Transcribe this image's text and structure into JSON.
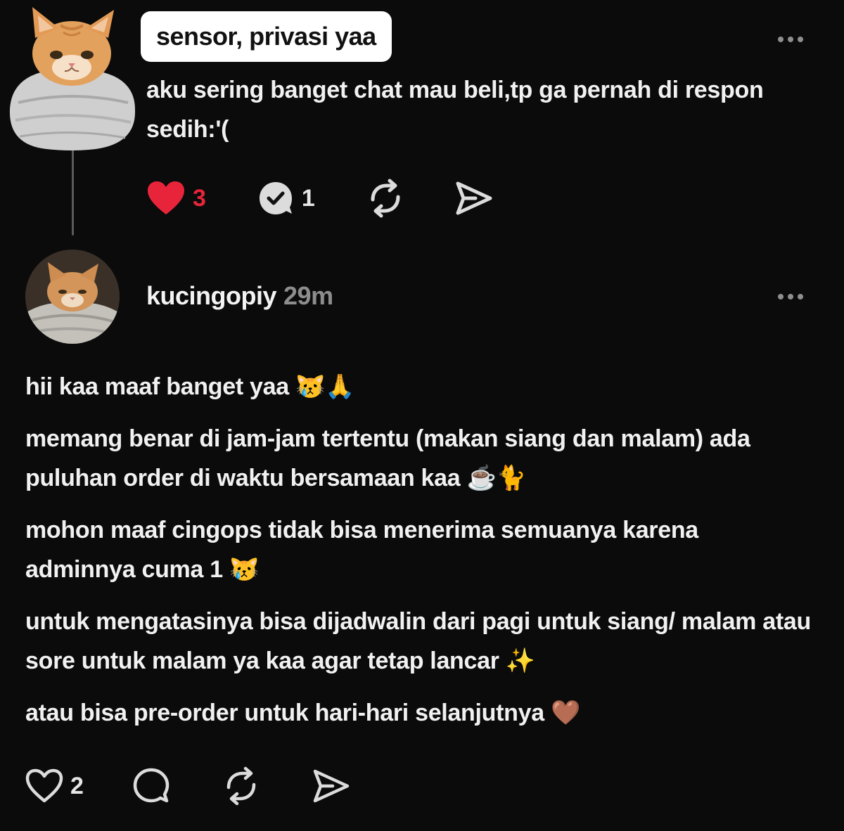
{
  "original_post": {
    "sticker_label": "sensor, privasi yaa",
    "text": "aku sering banget chat mau beli,tp ga pernah di respon sedih:'(",
    "likes": "3",
    "replies": "1",
    "like_color": "#e8243a"
  },
  "reply": {
    "username": "kucingopiy",
    "time": "29m",
    "paragraphs": [
      "hii kaa maaf banget yaa 😿🙏",
      "memang benar di jam-jam tertentu (makan siang dan malam) ada puluhan order di waktu bersamaan kaa ☕🐈",
      "mohon maaf cingops tidak bisa menerima semuanya karena adminnya cuma 1 😿",
      "untuk mengatasinya bisa dijadwalin dari pagi untuk siang/ malam atau sore untuk malam ya kaa agar tetap lancar ✨",
      "atau bisa pre-order untuk hari-hari selanjutnya 🤎"
    ],
    "likes": "2"
  }
}
